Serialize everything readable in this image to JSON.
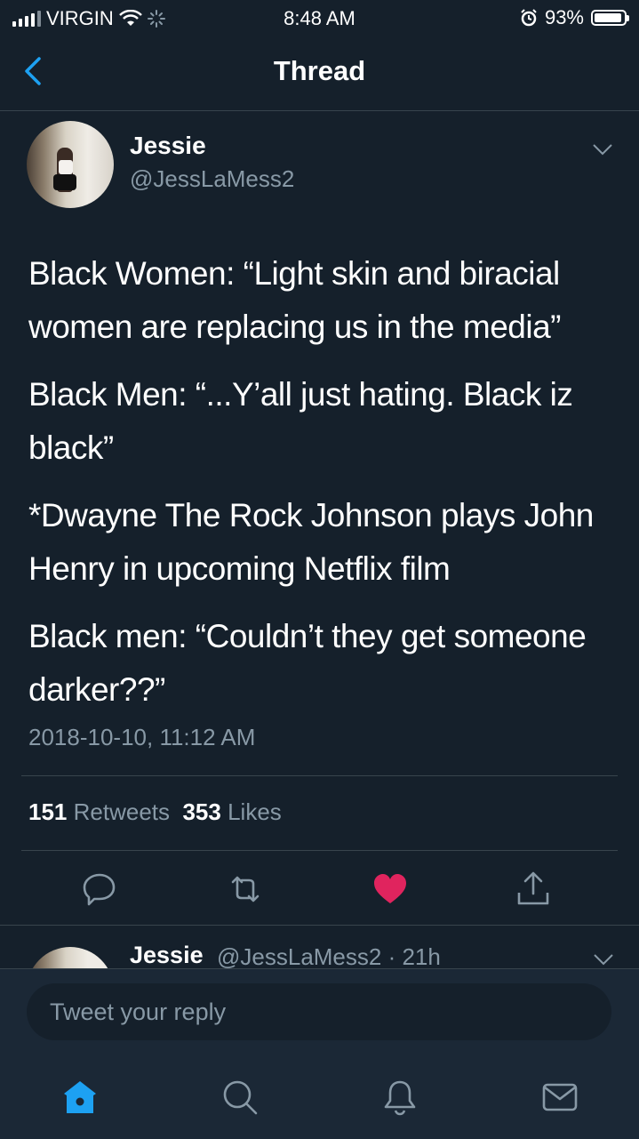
{
  "status_bar": {
    "carrier": "VIRGIN",
    "time": "8:48 AM",
    "battery": "93%",
    "battery_level": 0.93
  },
  "nav": {
    "title": "Thread"
  },
  "tweet": {
    "display_name": "Jessie",
    "handle": "@JessLaMess2",
    "paragraphs": [
      "Black Women: “Light skin and biracial women are replacing us in the media”",
      "Black Men: “...Y’all just hating. Black iz black”",
      "*Dwayne The Rock Johnson plays John Henry in upcoming Netflix film",
      "Black men: “Couldn’t they get someone darker??”"
    ],
    "timestamp": "2018-10-10, 11:12 AM",
    "retweets_count": "151",
    "retweets_label": "Retweets",
    "likes_count": "353",
    "likes_label": "Likes",
    "liked": true
  },
  "reply_preview": {
    "display_name": "Jessie",
    "meta": "@JessLaMess2 · 21h"
  },
  "reply_box": {
    "placeholder": "Tweet your reply"
  },
  "tab_bar": {
    "items": [
      "home-icon",
      "search-icon",
      "notifications-icon",
      "messages-icon"
    ],
    "active": "home-icon"
  },
  "colors": {
    "background": "#15202b",
    "accent": "#1da1f2",
    "like": "#e0245e",
    "secondary_text": "#8899a6"
  }
}
